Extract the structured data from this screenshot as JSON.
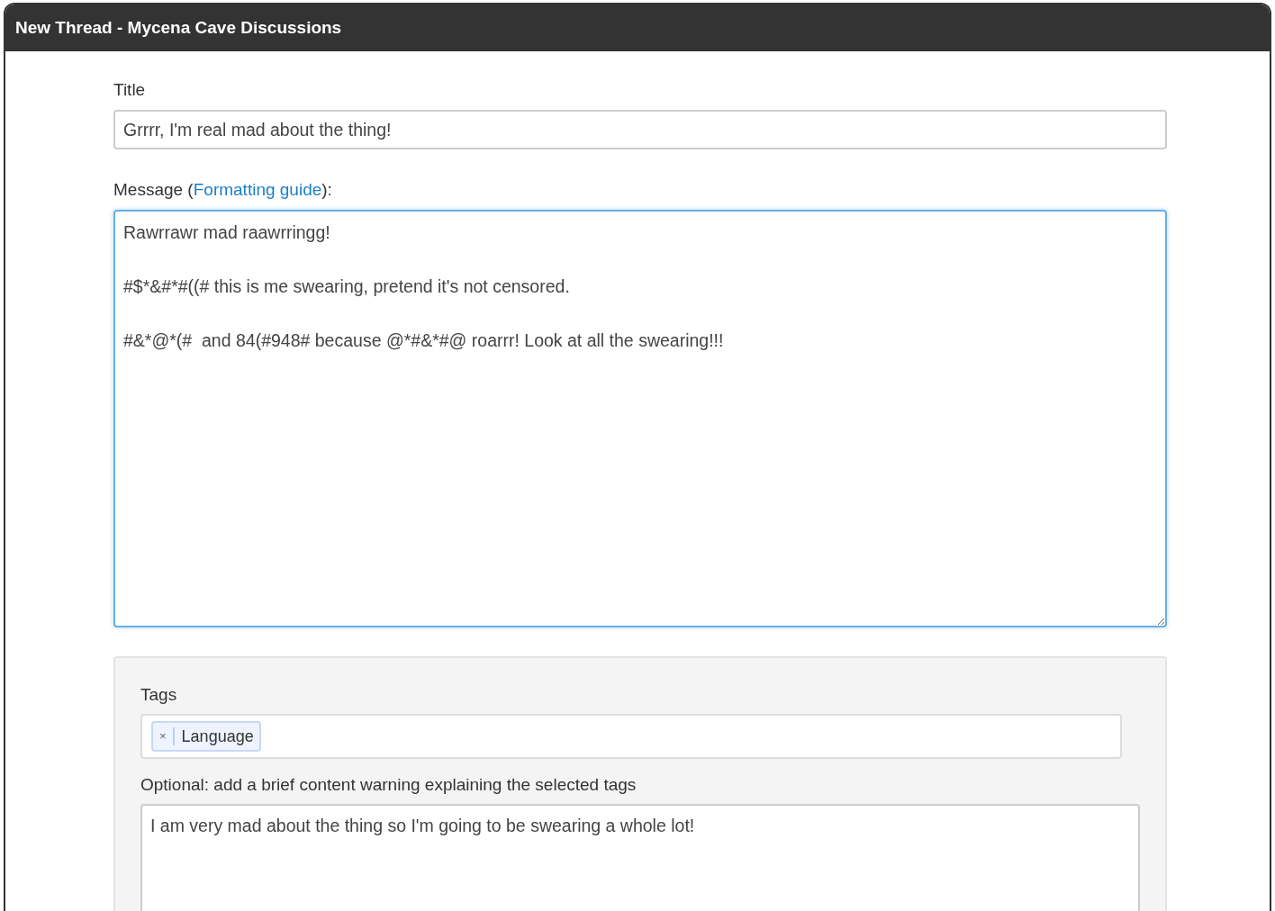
{
  "window": {
    "title": "New Thread - Mycena Cave Discussions"
  },
  "title_field": {
    "label": "Title",
    "value": "Grrrr, I'm real mad about the thing!",
    "focused": false
  },
  "message_field": {
    "label_before": "Message (",
    "link": "Formatting guide",
    "label_after": "):",
    "value": "Rawrrawr mad raawrringg!\n\n#$*&#*#((# this is me swearing, pretend it's not censored.\n\n#&*@*(#  and 84(#948# because @*#&*#@ roarrr! Look at all the swearing!!!",
    "focused": true
  },
  "tags_panel": {
    "label": "Tags",
    "tags": [
      {
        "remove": "×",
        "label": "Language"
      }
    ],
    "warning_label": "Optional: add a brief content warning explaining the selected tags",
    "warning_field": {
      "value": "I am very mad about the thing so I'm going to be swearing a whole lot!",
      "focused": false
    }
  }
}
